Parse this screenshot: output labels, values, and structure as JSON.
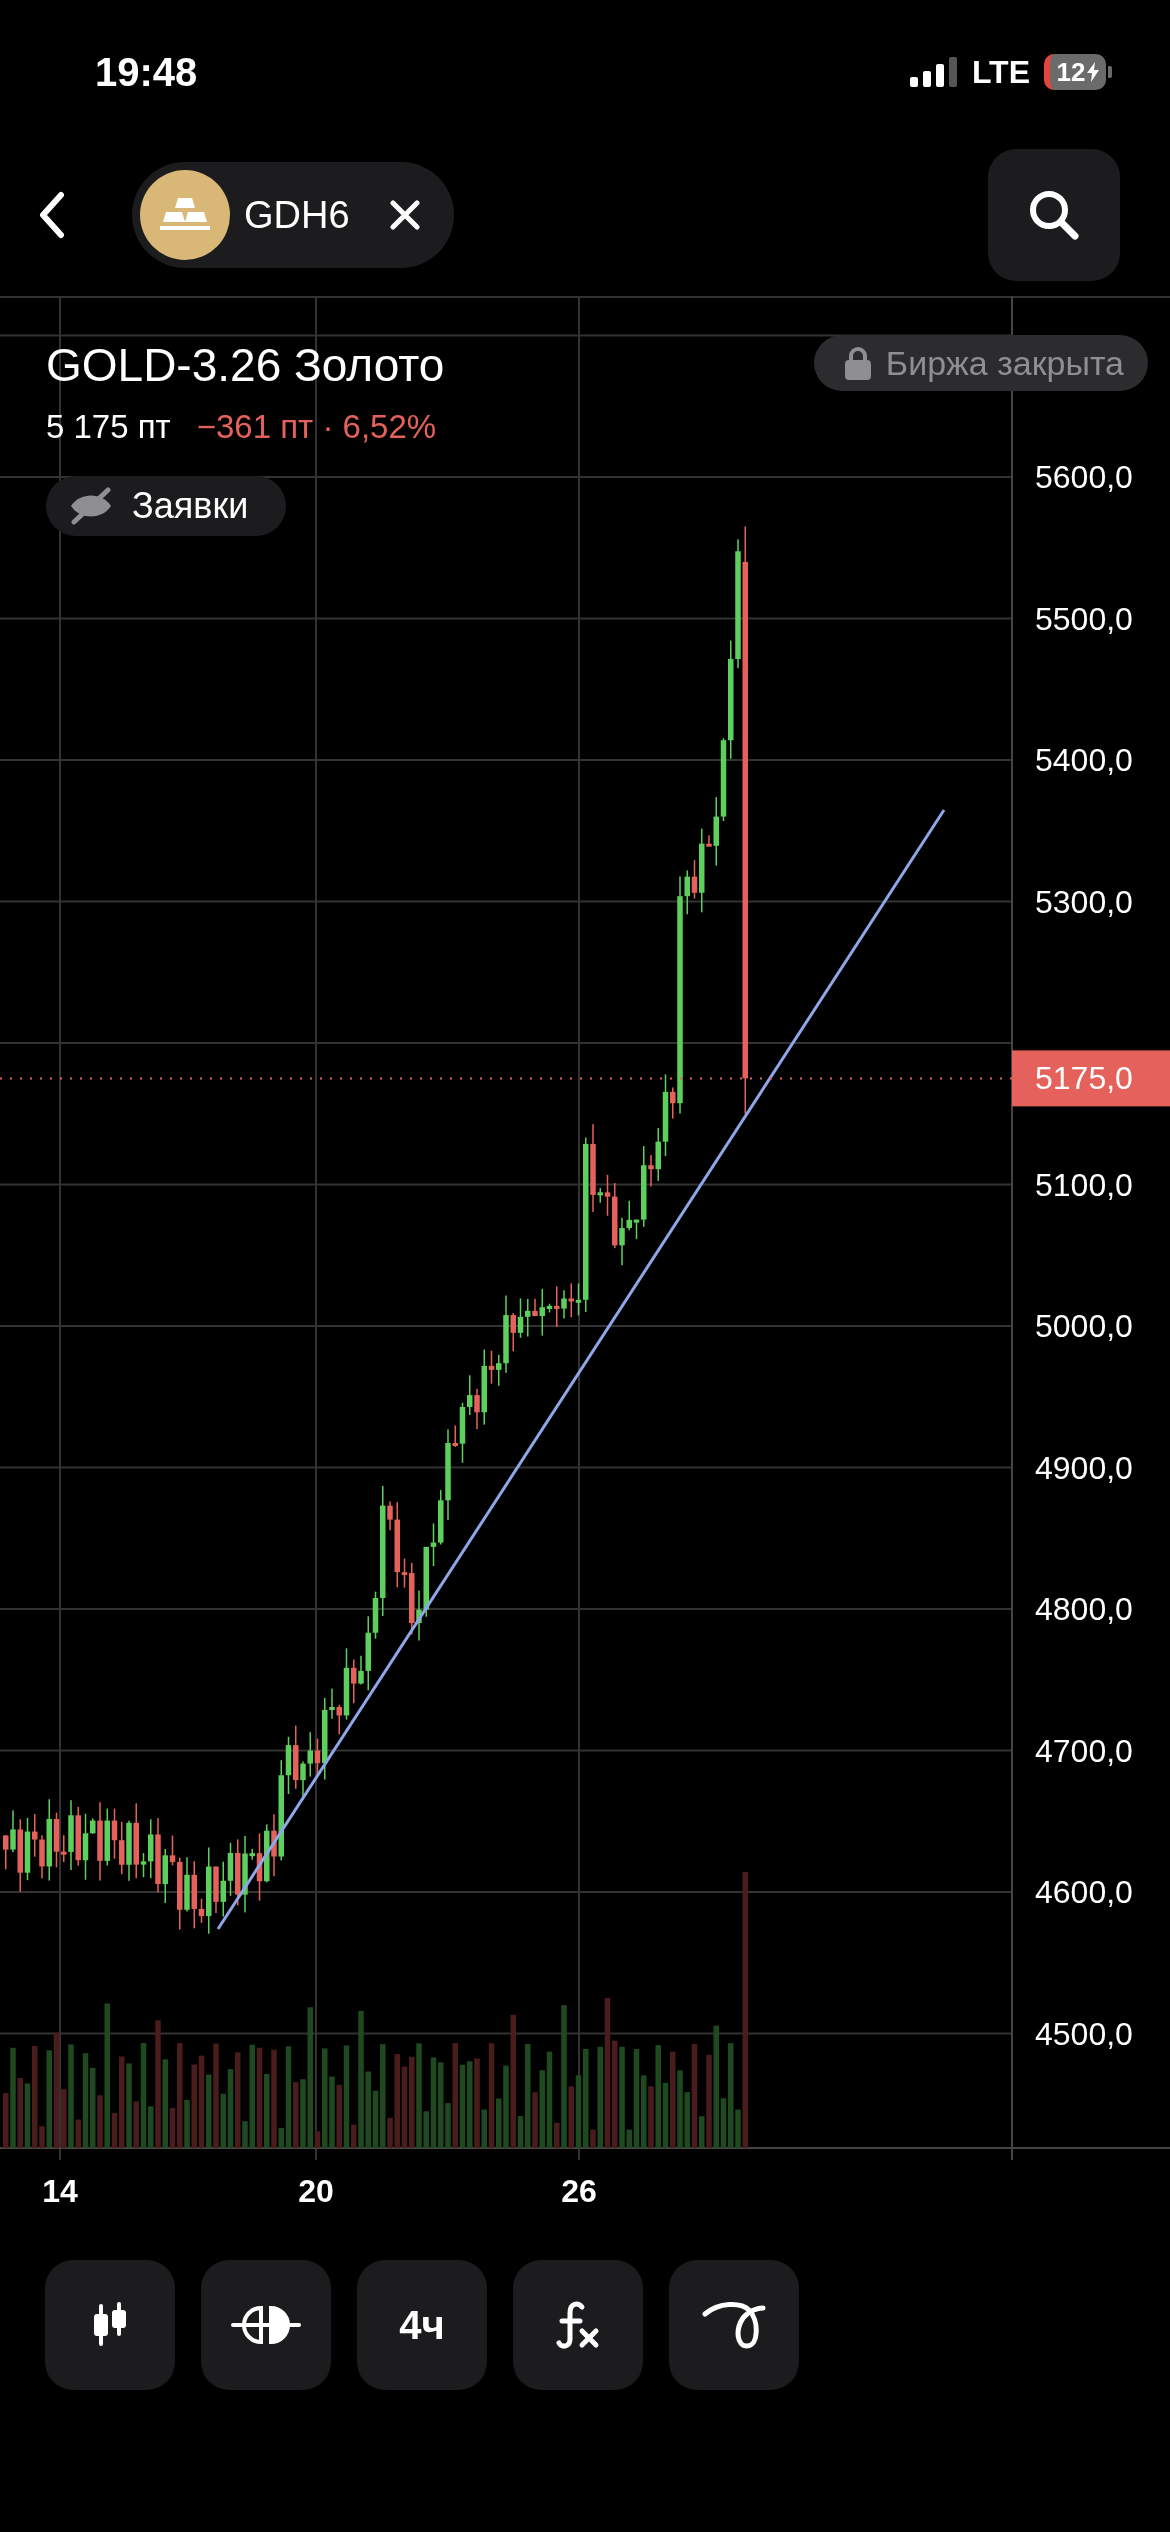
{
  "status_bar": {
    "time": "19:48",
    "network": "LTE",
    "battery": "12"
  },
  "nav": {
    "ticker": "GDH6"
  },
  "instrument": {
    "title": "GOLD-3.26 Золото",
    "price": "5 175 пт",
    "change": "−361 пт · 6,52%",
    "market_status": "Биржа закрыта",
    "orders_toggle": {
      "label": "Заявки",
      "on": false
    }
  },
  "chart": {
    "y_labels": [
      "5600,0",
      "5500,0",
      "5400,0",
      "5300,0",
      "5100,0",
      "5000,0",
      "4900,0",
      "4800,0",
      "4700,0",
      "4600,0",
      "4500,0"
    ],
    "x_labels": [
      "14",
      "20",
      "26"
    ],
    "current_price": "5175,0"
  },
  "toolbar": [
    {
      "kind": "candles"
    },
    {
      "kind": "indicators"
    },
    {
      "kind": "interval",
      "label": "4ч"
    },
    {
      "kind": "functions"
    },
    {
      "kind": "drawing"
    }
  ]
}
